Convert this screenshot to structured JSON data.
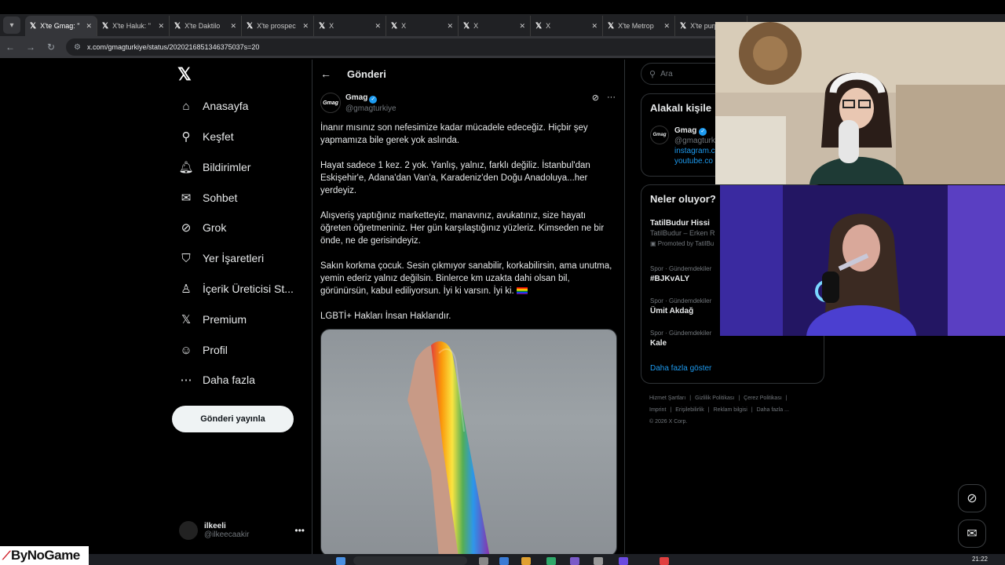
{
  "browser": {
    "tabs": [
      {
        "title": "X'te Gmag: \"",
        "active": true
      },
      {
        "title": "X'te Haluk: \""
      },
      {
        "title": "X'te Daktilo"
      },
      {
        "title": "X'te prospec"
      },
      {
        "title": "X"
      },
      {
        "title": "X"
      },
      {
        "title": "X"
      },
      {
        "title": "X"
      },
      {
        "title": "X'te Metrop"
      },
      {
        "title": "X'te purp"
      }
    ],
    "url": "x.com/gmagturkiye/status/2020216851346375037s=20"
  },
  "nav": {
    "items": [
      {
        "label": "Anasayfa",
        "icon": "home-icon"
      },
      {
        "label": "Keşfet",
        "icon": "search-icon"
      },
      {
        "label": "Bildirimler",
        "icon": "bell-icon"
      },
      {
        "label": "Sohbet",
        "icon": "mail-icon"
      },
      {
        "label": "Grok",
        "icon": "grok-icon"
      },
      {
        "label": "Yer İşaretleri",
        "icon": "bookmark-icon"
      },
      {
        "label": "İçerik Üreticisi St...",
        "icon": "creator-icon"
      },
      {
        "label": "Premium",
        "icon": "x-icon"
      },
      {
        "label": "Profil",
        "icon": "person-icon"
      },
      {
        "label": "Daha fazla",
        "icon": "more-icon"
      }
    ],
    "post_button": "Gönderi yayınla",
    "account": {
      "name": "ilkeeli",
      "handle": "@ilkeecaakir"
    }
  },
  "post": {
    "header": "Gönderi",
    "author": {
      "name": "Gmag",
      "handle": "@gmagturkiye",
      "avatar_text": "Gmag"
    },
    "paragraphs": [
      "İnanır mısınız son nefesimize kadar mücadele edeceğiz. Hiçbir şey yapmamıza bile gerek yok aslında.",
      "Hayat sadece 1 kez. 2 yok. Yanlış, yalnız, farklı değiliz. İstanbul'dan Eskişehir'e, Adana'dan Van'a, Karadeniz'den Doğu Anadoluya...her yerdeyiz.",
      "Alışveriş yaptığınız marketteyiz, manavınız, avukatınız, size hayatı öğreten öğretmeniniz. Her gün karşılaştığınız yüzleriz. Kimseden ne bir önde, ne de gerisindeyiz.",
      "Sakın korkma çocuk. Sesin çıkmıyor sanabilir, korkabilirsin, ama unutma, yemin ederiz yalnız değilsin. Binlerce km uzakta dahi olsan bil, görünürsün, kabul ediliyorsun. İyi ki varsın. İyi ki.",
      "LGBTİ+ Hakları İnsan Haklarıdır."
    ]
  },
  "sidebar": {
    "search_placeholder": "Ara",
    "related_title": "Alakalı kişile",
    "related": {
      "name": "Gmag",
      "handle": "@gmagturk",
      "link1": "instagram.c",
      "link2": "youtube.co"
    },
    "trends_title": "Neler oluyor?",
    "trends": [
      {
        "meta": "",
        "title": "TatilBudur Hissi",
        "sub": "TatilBudur – Erken R",
        "promo": "Promoted by TatilBu"
      },
      {
        "meta": "Spor · Gündemdekiler",
        "title": "#BJKvALY"
      },
      {
        "meta": "Spor · Gündemdekiler",
        "title": "Ümit Akdağ"
      },
      {
        "meta": "Spor · Gündemdekiler",
        "title": "Kale"
      }
    ],
    "show_more": "Daha fazla göster",
    "footer": [
      "Hizmet Şartları",
      "|",
      "Gizlilik Politikası",
      "|",
      "Çerez Politikası",
      "|",
      "Imprint",
      "|",
      "Erişilebilirlik",
      "|",
      "Reklam bilgisi",
      "|",
      "Daha fazla ...",
      "© 2026 X Corp."
    ]
  },
  "taskbar": {
    "time": "21:22"
  },
  "watermark": "ByNoGame",
  "colors": {
    "accent": "#1d9bf0",
    "bg": "#000000",
    "text": "#e7e9ea",
    "muted": "#71767b"
  }
}
